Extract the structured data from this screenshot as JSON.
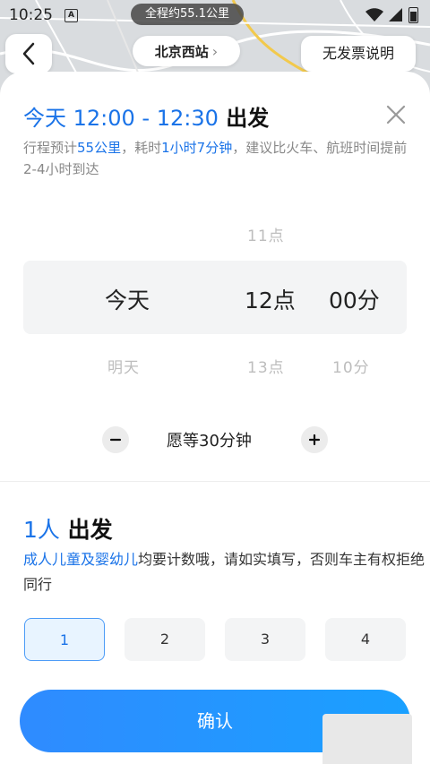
{
  "status_bar": {
    "time": "10:25",
    "notification_badge": "A",
    "trip_distance": "全程约55.1公里"
  },
  "nav": {
    "station": "北京西站",
    "station_chevron": "›",
    "invoice_label": "无发票说明"
  },
  "departure": {
    "title_time": "今天 12:00 - 12:30",
    "title_suffix": "出发",
    "desc_prefix": "行程预计",
    "desc_distance": "55公里",
    "desc_mid": "，耗时",
    "desc_duration": "1小时7分钟",
    "desc_suffix": "，建议比火车、航班时间提前2-4小时到达"
  },
  "picker": {
    "day_selected": "今天",
    "day_below": "明天",
    "hour_above": "11点",
    "hour_selected": "12点",
    "hour_below": "13点",
    "minute_selected": "00分",
    "minute_below": "10分"
  },
  "wait": {
    "label": "愿等30分钟"
  },
  "passengers": {
    "count_label": "1人",
    "title_suffix": "出发",
    "desc_highlight": "成人儿童及婴幼儿",
    "desc_rest": "均要计数哦，请如实填写，否则车主有权拒绝同行",
    "options": [
      "1",
      "2",
      "3",
      "4"
    ],
    "selected": "1"
  },
  "confirm_label": "确认",
  "colors": {
    "accent": "#1a73e8",
    "confirm_start": "#2f8bff",
    "confirm_end": "#1aa0ff"
  }
}
